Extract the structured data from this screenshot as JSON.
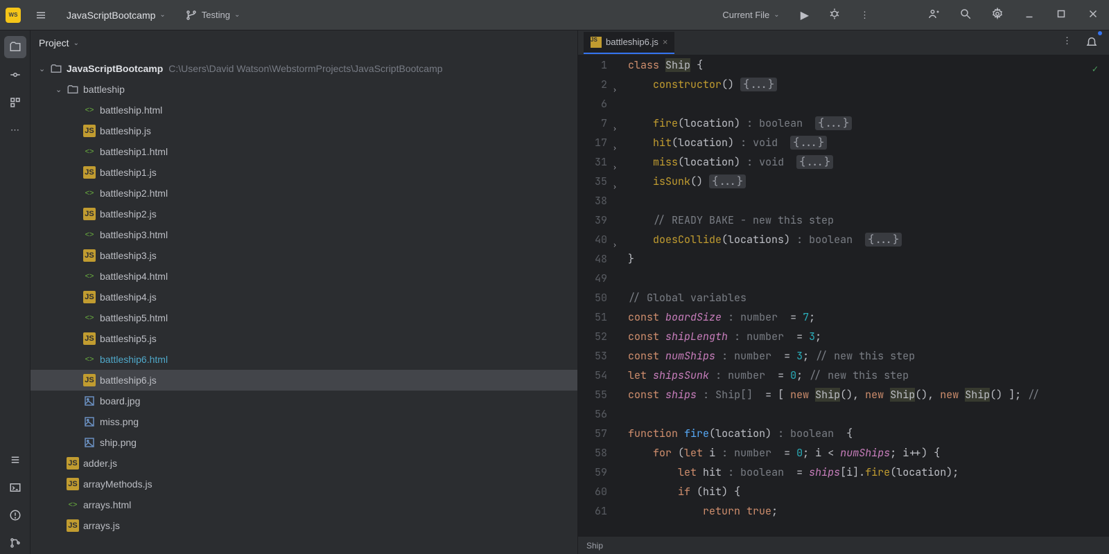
{
  "toolbar": {
    "project_name": "JavaScriptBootcamp",
    "branch": "Testing",
    "run_config": "Current File"
  },
  "panel": {
    "title": "Project"
  },
  "tree": {
    "root": {
      "name": "JavaScriptBootcamp",
      "path": "C:\\Users\\David Watson\\WebstormProjects\\JavaScriptBootcamp"
    },
    "folder": "battleship",
    "files": [
      {
        "name": "battleship.html",
        "type": "html"
      },
      {
        "name": "battleship.js",
        "type": "js"
      },
      {
        "name": "battleship1.html",
        "type": "html"
      },
      {
        "name": "battleship1.js",
        "type": "js"
      },
      {
        "name": "battleship2.html",
        "type": "html"
      },
      {
        "name": "battleship2.js",
        "type": "js"
      },
      {
        "name": "battleship3.html",
        "type": "html"
      },
      {
        "name": "battleship3.js",
        "type": "js"
      },
      {
        "name": "battleship4.html",
        "type": "html"
      },
      {
        "name": "battleship4.js",
        "type": "js"
      },
      {
        "name": "battleship5.html",
        "type": "html"
      },
      {
        "name": "battleship5.js",
        "type": "js"
      },
      {
        "name": "battleship6.html",
        "type": "html",
        "highlight": true
      },
      {
        "name": "battleship6.js",
        "type": "js",
        "selected": true
      },
      {
        "name": "board.jpg",
        "type": "img"
      },
      {
        "name": "miss.png",
        "type": "img"
      },
      {
        "name": "ship.png",
        "type": "img"
      }
    ],
    "rootFiles": [
      {
        "name": "adder.js",
        "type": "js"
      },
      {
        "name": "arrayMethods.js",
        "type": "js"
      },
      {
        "name": "arrays.html",
        "type": "html"
      },
      {
        "name": "arrays.js",
        "type": "js"
      }
    ]
  },
  "tab": {
    "name": "battleship6.js"
  },
  "breadcrumb": "Ship",
  "code": {
    "lines": [
      {
        "n": 1,
        "html": "<span class='kw'>class</span> <span class='hl cls'>Ship</span> <span class='cls'>{</span>"
      },
      {
        "n": 2,
        "fold": true,
        "html": "    <span class='fn'>constructor</span><span class='cls'>()</span> <span class='collapsed'>{...}</span>"
      },
      {
        "n": 6,
        "html": ""
      },
      {
        "n": 7,
        "fold": true,
        "html": "    <span class='fn'>fire</span><span class='cls'>(</span><span class='param'>location</span><span class='cls'>)</span> <span class='type'>: boolean</span>  <span class='collapsed'>{...}</span>"
      },
      {
        "n": 17,
        "fold": true,
        "html": "    <span class='fn'>hit</span><span class='cls'>(</span><span class='param'>location</span><span class='cls'>)</span> <span class='type'>: void</span>  <span class='collapsed'>{...}</span>"
      },
      {
        "n": 31,
        "fold": true,
        "html": "    <span class='fn'>miss</span><span class='cls'>(</span><span class='param'>location</span><span class='cls'>)</span> <span class='type'>: void</span>  <span class='collapsed'>{...}</span>"
      },
      {
        "n": 35,
        "fold": true,
        "html": "    <span class='fn'>isSunk</span><span class='cls'>()</span> <span class='collapsed'>{...}</span>"
      },
      {
        "n": 38,
        "html": ""
      },
      {
        "n": 39,
        "html": "    <span class='com'>// READY BAKE - new this step</span>"
      },
      {
        "n": 40,
        "fold": true,
        "html": "    <span class='fn'>doesCollide</span><span class='cls'>(</span><span class='param'>locations</span><span class='cls'>)</span> <span class='type'>: boolean</span>  <span class='collapsed'>{...}</span>"
      },
      {
        "n": 48,
        "html": "<span class='cls'>}</span>"
      },
      {
        "n": 49,
        "html": ""
      },
      {
        "n": 50,
        "html": "<span class='com'>// Global variables</span>"
      },
      {
        "n": 51,
        "html": "<span class='kw'>const</span> <span class='ident'>boardSize</span> <span class='type'>: number</span>  = <span class='num'>7</span>;"
      },
      {
        "n": 52,
        "html": "<span class='kw'>const</span> <span class='ident'>shipLength</span> <span class='type'>: number</span>  = <span class='num'>3</span>;"
      },
      {
        "n": 53,
        "html": "<span class='kw'>const</span> <span class='ident'>numShips</span> <span class='type'>: number</span>  = <span class='num'>3</span>; <span class='com'>// new this step</span>"
      },
      {
        "n": 54,
        "html": "<span class='kw'>let</span> <span class='ident'>shipsSunk</span> <span class='type'>: number</span>  = <span class='num'>0</span>; <span class='com'>// new this step</span>"
      },
      {
        "n": 55,
        "html": "<span class='kw'>const</span> <span class='ident'>ships</span> <span class='type'>: Ship[]</span>  = [ <span class='kw'>new</span> <span class='hl cls'>Ship</span>(), <span class='kw'>new</span> <span class='hl cls'>Ship</span>(), <span class='kw'>new</span> <span class='hl cls'>Ship</span>() ]; <span class='com'>//</span>"
      },
      {
        "n": 56,
        "html": ""
      },
      {
        "n": 57,
        "html": "<span class='kw'>function</span> <span class='fnname'>fire</span><span class='cls'>(</span><span class='param'>location</span><span class='cls'>)</span> <span class='type'>: boolean</span>  <span class='cls'>{</span>"
      },
      {
        "n": 58,
        "html": "    <span class='kw'>for</span> (<span class='kw'>let</span> <span class='param'>i</span> <span class='type'>: number</span>  = <span class='num'>0</span>; <span class='param'>i</span> &lt; <span class='ident'>numShips</span>; <span class='param'>i</span>++) {"
      },
      {
        "n": 59,
        "html": "        <span class='kw'>let</span> <span class='param'>hit</span> <span class='type'>: boolean</span>  = <span class='ident'>ships</span>[<span class='param'>i</span>].<span class='fn'>fire</span>(<span class='param'>location</span>);"
      },
      {
        "n": 60,
        "html": "        <span class='kw'>if</span> (<span class='param'>hit</span>) {"
      },
      {
        "n": 61,
        "html": "            <span class='kw'>return</span> <span class='kw'>true</span>;"
      }
    ]
  }
}
